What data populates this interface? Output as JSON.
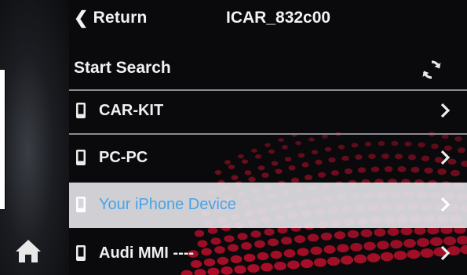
{
  "header": {
    "return_label": "Return",
    "title": "ICAR_832c00"
  },
  "search": {
    "label": "Start Search",
    "icon": "refresh-icon"
  },
  "devices": [
    {
      "label": "CAR-KIT",
      "icon": "phone-icon",
      "selected": false
    },
    {
      "label": "PC-PC",
      "icon": "phone-icon",
      "selected": false
    },
    {
      "label": "Your iPhone Device",
      "icon": "phone-icon",
      "selected": true
    },
    {
      "label": "Audi MMI ----",
      "icon": "phone-icon",
      "selected": false
    }
  ],
  "sidebar": {
    "home_icon": "home-icon"
  },
  "colors": {
    "background": "#0a0a0c",
    "text": "#f0f0f0",
    "selected_row": "#e1e1e6",
    "selected_text": "#4aa3e6",
    "decoration": "#c8102e"
  }
}
